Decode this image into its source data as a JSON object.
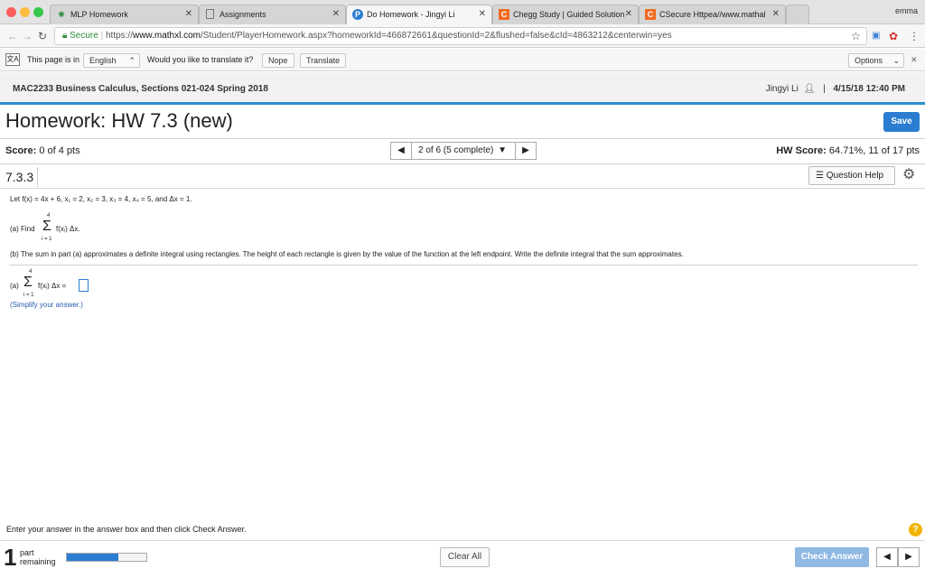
{
  "browser": {
    "tabs": [
      {
        "title": "MLP Homework",
        "icon": "globe-icon"
      },
      {
        "title": "Assignments",
        "icon": "document-icon"
      },
      {
        "title": "Do Homework - Jingyi Li",
        "icon": "pearson-icon"
      },
      {
        "title": "Chegg Study | Guided Solution",
        "icon": "chegg-icon"
      },
      {
        "title": "CSecure Httpea//www.mathal",
        "icon": "chegg-icon"
      }
    ],
    "active_tab": 2,
    "profile_name": "emma",
    "address": {
      "secure_label": "Secure",
      "url_prefix": "https://",
      "url_host": "www.mathxl.com",
      "url_path": "/Student/PlayerHomework.aspx?homeworkId=466872661&questionId=2&flushed=false&cId=4863212&centerwin=yes"
    }
  },
  "translate_bar": {
    "prefix": "This page is in",
    "language": "English",
    "question": "Would you like to translate it?",
    "nope": "Nope",
    "translate": "Translate",
    "options": "Options"
  },
  "course": {
    "title": "MAC2233 Business Calculus, Sections 021-024 Spring 2018",
    "user": "Jingyi Li",
    "separator": "|",
    "datetime": "4/15/18 12:40 PM"
  },
  "homework": {
    "title": "Homework: HW 7.3 (new)",
    "save": "Save",
    "score_label": "Score:",
    "score_value": "0 of 4 pts",
    "pager_label": "2 of 6 (5 complete)",
    "hw_score_label": "HW Score:",
    "hw_score_value": "64.71%, 11 of 17 pts"
  },
  "question": {
    "number": "7.3.3",
    "help": "Question Help",
    "given": "Let f(x) = 4x + 6, x₁ = 2, x₂ = 3, x₃ = 4, x₄ = 5, and Δx = 1.",
    "part_a_label": "(a) Find",
    "sum_upper": "4",
    "sum_lower": "i = 1",
    "sigma": "Σ",
    "sum_term": "f(xᵢ) Δx.",
    "part_b": "(b) The sum in part (a) approximates a definite integral using rectangles. The height of each rectangle is given by the value of the function at the left endpoint. Write the definite integral that the sum approximates.",
    "answer_label": "(a)",
    "answer_term": "f(xᵢ) Δx =",
    "simplify": "(Simplify your answer.)"
  },
  "footer": {
    "instruction": "Enter your answer in the answer box and then click Check Answer.",
    "help_mark": "?",
    "parts_count": "1",
    "parts_label_1": "part",
    "parts_label_2": "remaining",
    "progress_fraction": 0.65,
    "clear_all": "Clear All",
    "check_answer": "Check Answer"
  },
  "colors": {
    "accent": "#2a7dd1",
    "header_rule": "#2a8fd0",
    "secure_green": "#2a8a3c",
    "help_yellow": "#f0b400"
  }
}
